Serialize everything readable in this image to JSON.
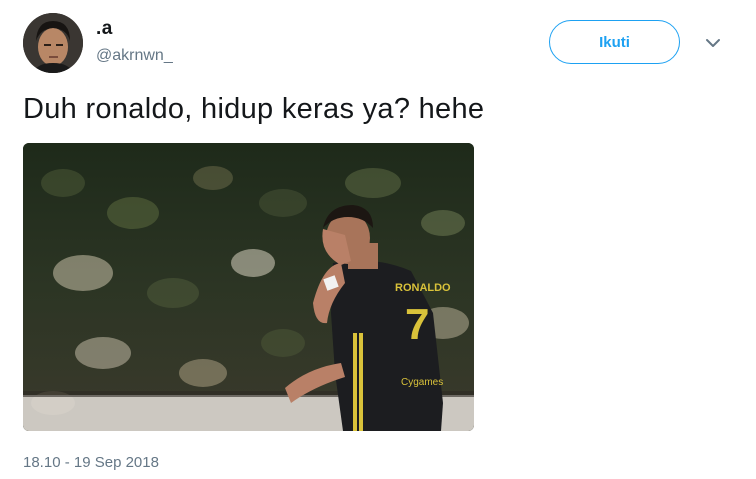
{
  "user": {
    "display_name": ".a",
    "handle": "@akrnwn_",
    "avatar_icon": "user-avatar-photo"
  },
  "follow_button": {
    "label": "Ikuti"
  },
  "menu": {
    "icon": "chevron-down-icon"
  },
  "tweet": {
    "text": "Duh ronaldo, hidup keras ya? hehe",
    "timestamp": "18.10 - 19 Sep 2018"
  },
  "photo": {
    "description_icon": "footballer-photo",
    "jersey_number": "7",
    "jersey_name": "RONALDO",
    "sponsor": "Cygames"
  },
  "colors": {
    "accent": "#1da1f2",
    "text": "#14171a",
    "secondary_text": "#657786"
  }
}
